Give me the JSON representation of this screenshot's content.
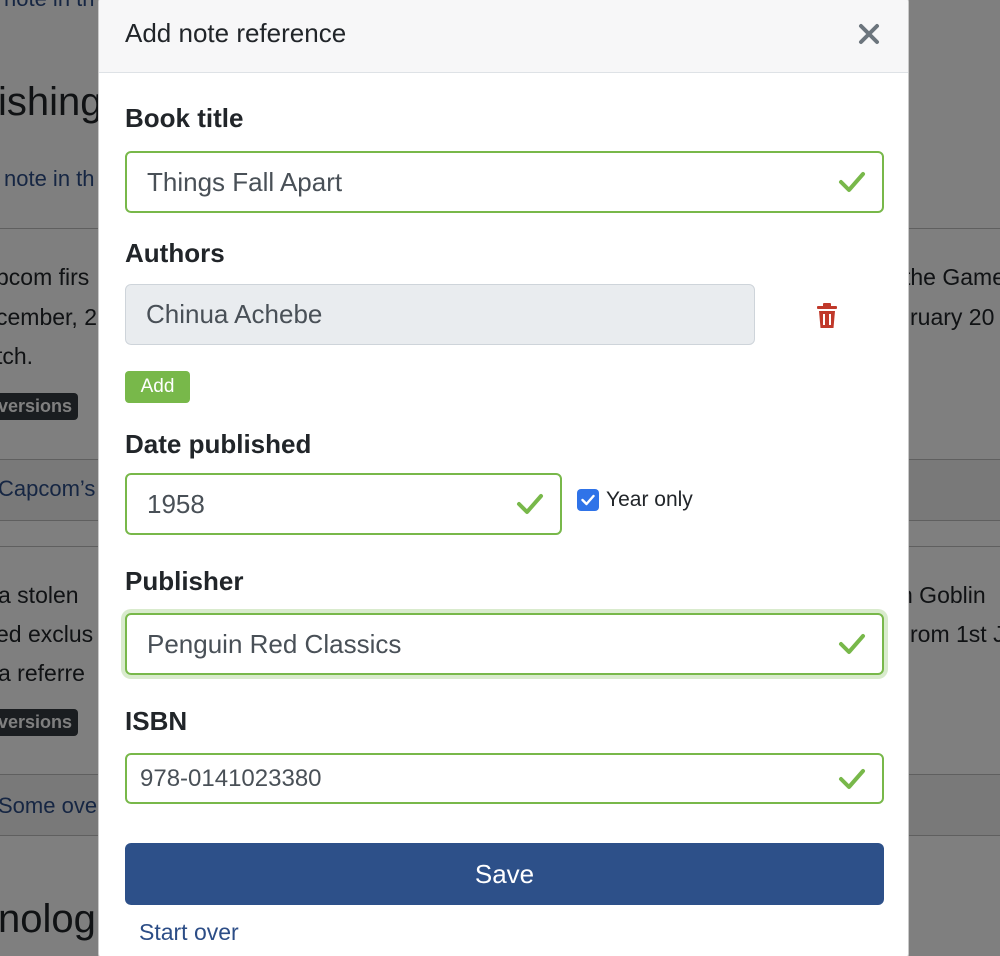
{
  "background": {
    "link_top": "note in th",
    "heading_1": "ishing",
    "link_1": "note in th",
    "text_lines_1": [
      "pcom firs",
      "cember, 2",
      "tch."
    ],
    "text_right_1": [
      "the Game",
      "ruary 20"
    ],
    "badge_1": "versions",
    "link_2": "Capcom’s",
    "text_lines_2": [
      "a stolen",
      "ed exclus",
      "a referre"
    ],
    "text_right_2": [
      "n Goblin",
      "rom 1st J"
    ],
    "badge_2": "versions",
    "link_3": "Some over",
    "heading_2": "nolog"
  },
  "modal": {
    "title": "Add note reference",
    "close_icon": "close-icon",
    "book_title": {
      "label": "Book title",
      "value": "Things Fall Apart",
      "valid": true
    },
    "authors": {
      "label": "Authors",
      "items": [
        {
          "value": "Chinua Achebe"
        }
      ],
      "add_label": "Add",
      "remove_icon": "trash-icon"
    },
    "date_published": {
      "label": "Date published",
      "value": "1958",
      "valid": true,
      "year_only_label": "Year only",
      "year_only_checked": true
    },
    "publisher": {
      "label": "Publisher",
      "value": "Penguin Red Classics",
      "valid": true,
      "focused": true
    },
    "isbn": {
      "label": "ISBN",
      "value": "978-0141023380",
      "valid": true
    },
    "save_label": "Save",
    "start_over_label": "Start over"
  },
  "colors": {
    "valid": "#78b84a",
    "primary": "#2d5089",
    "danger": "#c0392b",
    "checkbox": "#2f73e8",
    "link": "#2c4d86",
    "overlay": "rgba(0,0,0,0.5)"
  }
}
